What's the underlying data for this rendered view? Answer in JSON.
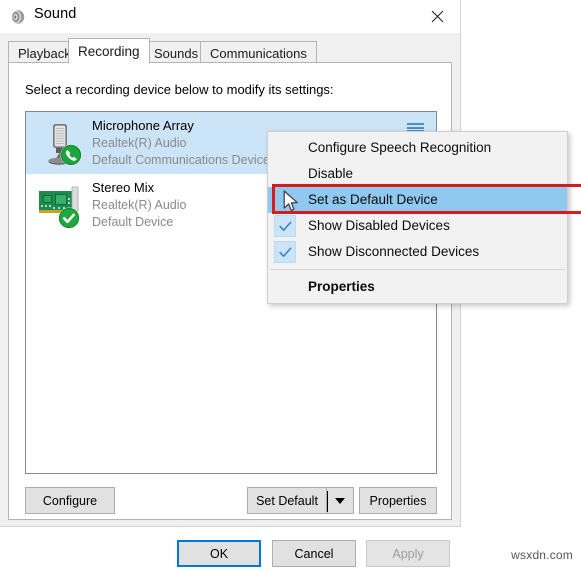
{
  "window": {
    "title": "Sound",
    "icon": "speaker-icon",
    "close_label": "✕"
  },
  "tabs": [
    {
      "label": "Playback",
      "selected": false
    },
    {
      "label": "Recording",
      "selected": true
    },
    {
      "label": "Sounds",
      "selected": false
    },
    {
      "label": "Communications",
      "selected": false
    }
  ],
  "panel": {
    "instruction": "Select a recording device below to modify its settings:",
    "devices": [
      {
        "name": "Microphone Array",
        "driver": "Realtek(R) Audio",
        "status": "Default Communications Device",
        "icon": "microphone-icon",
        "badge": "phone-badge",
        "selected": true,
        "has_row_menu": true
      },
      {
        "name": "Stereo Mix",
        "driver": "Realtek(R) Audio",
        "status": "Default Device",
        "icon": "sound-card-icon",
        "badge": "check-badge",
        "selected": false,
        "has_row_menu": false
      }
    ],
    "buttons": {
      "configure": "Configure",
      "set_default": "Set Default",
      "properties": "Properties"
    }
  },
  "dialog_buttons": {
    "ok": "OK",
    "cancel": "Cancel",
    "apply": "Apply"
  },
  "context_menu": {
    "items": [
      {
        "label": "Configure Speech Recognition",
        "checked": false,
        "highlight": false,
        "bold": false
      },
      {
        "label": "Disable",
        "checked": false,
        "highlight": false,
        "bold": false
      },
      {
        "label": "Set as Default Device",
        "checked": false,
        "highlight": true,
        "bold": false
      },
      {
        "label": "Show Disabled Devices",
        "checked": true,
        "highlight": false,
        "bold": false
      },
      {
        "label": "Show Disconnected Devices",
        "checked": true,
        "highlight": false,
        "bold": false
      },
      {
        "label": "Properties",
        "checked": false,
        "highlight": false,
        "bold": true
      }
    ]
  },
  "annotation": {
    "highlight_color": "#d61b1b",
    "target_label": "Set as Default Device"
  },
  "watermark": {
    "text": "wsxdn.com"
  }
}
